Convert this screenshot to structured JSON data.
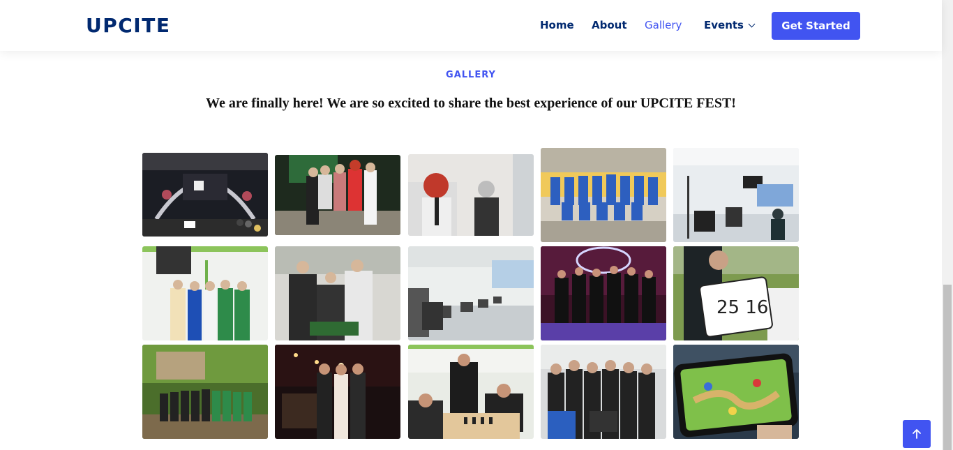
{
  "header": {
    "logo": "UPCITE",
    "nav": [
      {
        "label": "Home"
      },
      {
        "label": "About"
      },
      {
        "label": "Gallery"
      },
      {
        "label": "Events"
      }
    ],
    "cta_label": "Get Started"
  },
  "section": {
    "tag": "GALLERY",
    "title": "We are finally here! We are so excited to share the best experience of our UPCITE FEST!"
  },
  "gallery": {
    "photos": [
      {
        "scene": "stage event"
      },
      {
        "scene": "costumed group"
      },
      {
        "scene": "cosplay portrait"
      },
      {
        "scene": "basketball team"
      },
      {
        "scene": "computer lab"
      },
      {
        "scene": "group photo lab"
      },
      {
        "scene": "chess handshake"
      },
      {
        "scene": "computer room"
      },
      {
        "scene": "neon party group"
      },
      {
        "scene": "whiteboard score"
      },
      {
        "scene": "outdoor team"
      },
      {
        "scene": "night group"
      },
      {
        "scene": "chess match"
      },
      {
        "scene": "group selfie"
      },
      {
        "scene": "mobile game"
      }
    ],
    "whiteboard_text": "25 16"
  },
  "colors": {
    "accent": "#4154f1",
    "navy": "#012970"
  },
  "icons": {
    "events_dropdown": "chevron-down-icon",
    "back_to_top": "arrow-up-icon"
  }
}
